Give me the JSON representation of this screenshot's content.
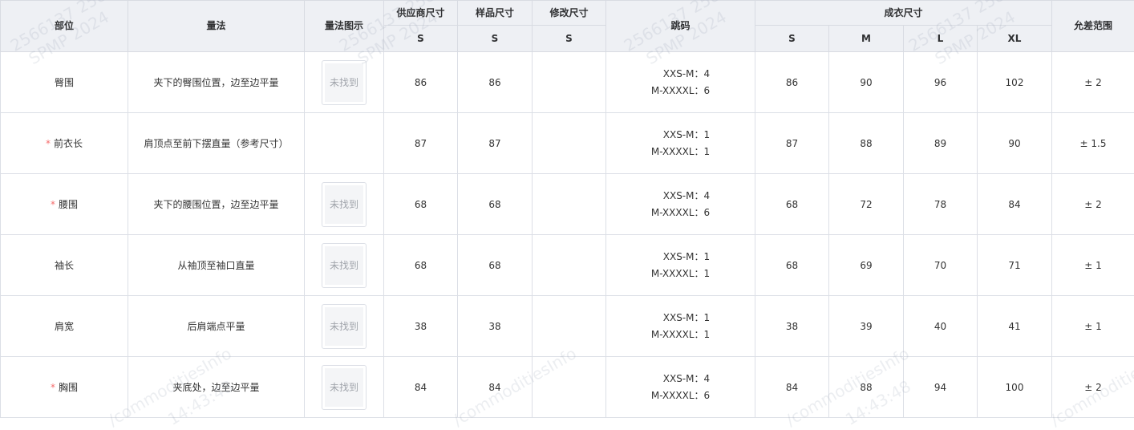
{
  "headers": {
    "part": "部位",
    "method": "量法",
    "method_image": "量法图示",
    "supplier_size": "供应商尺寸",
    "sample_size": "样品尺寸",
    "modified_size": "修改尺寸",
    "jump": "跳码",
    "garment_size": "成衣尺寸",
    "tolerance": "允差范围",
    "supplier_sub": "S",
    "sample_sub": "S",
    "modified_sub": "S",
    "garment_sizes": [
      "S",
      "M",
      "L",
      "XL"
    ]
  },
  "image_placeholder": "未找到",
  "required_mark": "*",
  "rows": [
    {
      "part": "臀围",
      "required": false,
      "method": "夹下的臀围位置，边至边平量",
      "has_image": true,
      "supplier": "86",
      "sample": "86",
      "modified": "",
      "jump1": "XXS-M：4",
      "jump2": "M-XXXXL：6",
      "sizes": [
        "86",
        "90",
        "96",
        "102"
      ],
      "tolerance": "± 2"
    },
    {
      "part": "前衣长",
      "required": true,
      "method": "肩顶点至前下摆直量（参考尺寸）",
      "has_image": false,
      "supplier": "87",
      "sample": "87",
      "modified": "",
      "jump1": "XXS-M：1",
      "jump2": "M-XXXXL：1",
      "sizes": [
        "87",
        "88",
        "89",
        "90"
      ],
      "tolerance": "± 1.5"
    },
    {
      "part": "腰围",
      "required": true,
      "method": "夹下的腰围位置，边至边平量",
      "has_image": true,
      "supplier": "68",
      "sample": "68",
      "modified": "",
      "jump1": "XXS-M：4",
      "jump2": "M-XXXXL：6",
      "sizes": [
        "68",
        "72",
        "78",
        "84"
      ],
      "tolerance": "± 2"
    },
    {
      "part": "袖长",
      "required": false,
      "method": "从袖顶至袖口直量",
      "has_image": true,
      "supplier": "68",
      "sample": "68",
      "modified": "",
      "jump1": "XXS-M：1",
      "jump2": "M-XXXXL：1",
      "sizes": [
        "68",
        "69",
        "70",
        "71"
      ],
      "tolerance": "± 1"
    },
    {
      "part": "肩宽",
      "required": false,
      "method": "后肩端点平量",
      "has_image": true,
      "supplier": "38",
      "sample": "38",
      "modified": "",
      "jump1": "XXS-M：1",
      "jump2": "M-XXXXL：1",
      "sizes": [
        "38",
        "39",
        "40",
        "41"
      ],
      "tolerance": "± 1"
    },
    {
      "part": "胸围",
      "required": true,
      "method": "夹底处，边至边平量",
      "has_image": true,
      "supplier": "84",
      "sample": "84",
      "modified": "",
      "jump1": "XXS-M：4",
      "jump2": "M-XXXXL：6",
      "sizes": [
        "84",
        "88",
        "94",
        "100"
      ],
      "tolerance": "± 2"
    }
  ],
  "watermark_texts": [
    "2566137 2589",
    "SPMP 2024",
    "/commoditiesInfo",
    "14:43:48"
  ]
}
